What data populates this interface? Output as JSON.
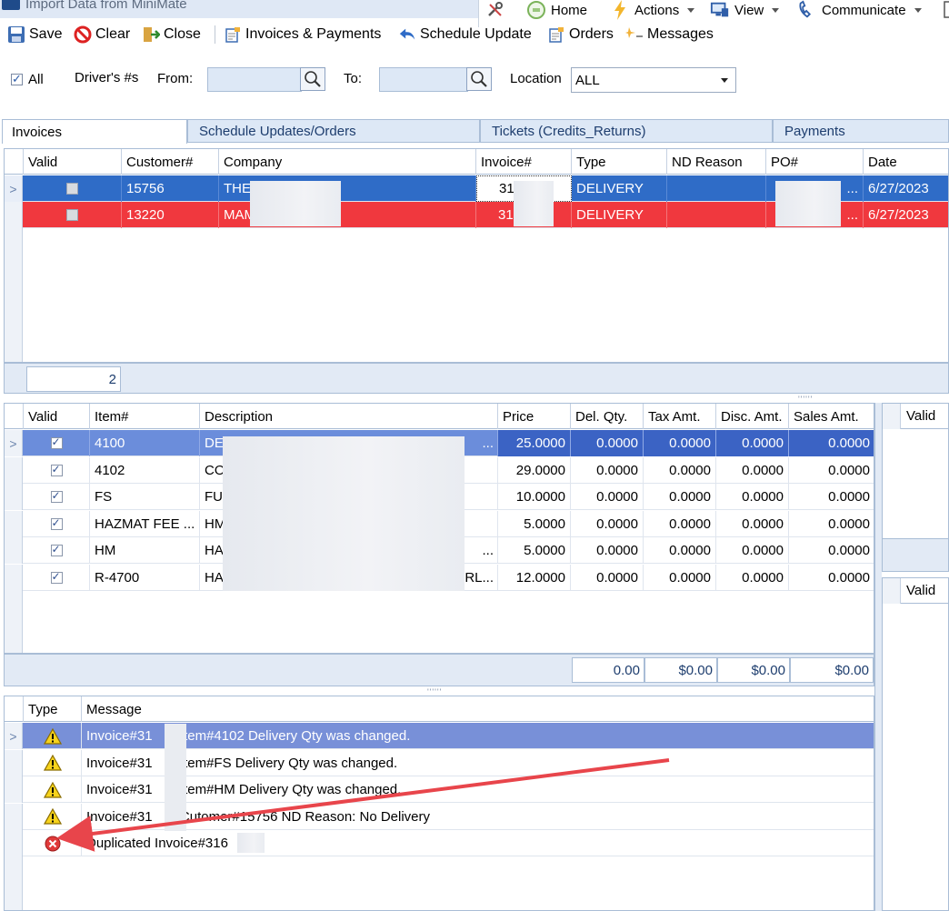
{
  "window": {
    "title": "Import Data from MiniMate"
  },
  "top_menu": [
    {
      "label": "Home",
      "icon": "home-icon"
    },
    {
      "label": "Actions",
      "icon": "lightning-icon"
    },
    {
      "label": "View",
      "icon": "monitor-icon"
    },
    {
      "label": "Communicate",
      "icon": "phone-icon"
    }
  ],
  "toolbar": {
    "save_label": "Save",
    "clear_label": "Clear",
    "close_label": "Close",
    "invoices_payments_label": "Invoices & Payments",
    "schedule_update_label": "Schedule Update",
    "orders_label": "Orders",
    "messages_label": "Messages"
  },
  "filters": {
    "all_label": "All",
    "all_checked": true,
    "drivers_label": "Driver's #s",
    "from_label": "From:",
    "to_label": "To:",
    "location_label": "Location",
    "location_value": "ALL"
  },
  "tabs": [
    {
      "label": "Invoices",
      "active": true
    },
    {
      "label": "Schedule Updates/Orders",
      "active": false
    },
    {
      "label": "Tickets (Credits_Returns)",
      "active": false
    },
    {
      "label": "Payments",
      "active": false
    }
  ],
  "invoices_grid": {
    "headers": [
      "Valid",
      "Customer#",
      "Company",
      "Invoice#",
      "Type",
      "ND Reason",
      "PO#",
      "Date"
    ],
    "rows": [
      {
        "customer": "15756",
        "company": "THE",
        "invoice": "31",
        "type": "DELIVERY",
        "nd_reason": "",
        "po": "...",
        "date": "6/27/2023"
      },
      {
        "customer": "13220",
        "company": "MAM",
        "invoice": "31",
        "type": "DELIVERY",
        "nd_reason": "",
        "po": "...",
        "date": "6/27/2023"
      }
    ],
    "count": "2"
  },
  "items_grid": {
    "headers": [
      "Valid",
      "Item#",
      "Description",
      "Price",
      "Del. Qty.",
      "Tax Amt.",
      "Disc. Amt.",
      "Sales Amt."
    ],
    "rows": [
      {
        "item": "4100",
        "desc": "DE",
        "desc_tail": "...",
        "price": "25.0000",
        "qty": "0.0000",
        "tax": "0.0000",
        "disc": "0.0000",
        "sales": "0.0000"
      },
      {
        "item": "4102",
        "desc": "CO",
        "desc_tail": "",
        "price": "29.0000",
        "qty": "0.0000",
        "tax": "0.0000",
        "disc": "0.0000",
        "sales": "0.0000"
      },
      {
        "item": "FS",
        "desc": "FU",
        "desc_tail": "",
        "price": "10.0000",
        "qty": "0.0000",
        "tax": "0.0000",
        "disc": "0.0000",
        "sales": "0.0000"
      },
      {
        "item": "HAZMAT FEE ...",
        "desc": "HM",
        "desc_tail": "",
        "price": "5.0000",
        "qty": "0.0000",
        "tax": "0.0000",
        "disc": "0.0000",
        "sales": "0.0000"
      },
      {
        "item": "HM",
        "desc": "HA",
        "desc_tail": "...",
        "price": "5.0000",
        "qty": "0.0000",
        "tax": "0.0000",
        "disc": "0.0000",
        "sales": "0.0000"
      },
      {
        "item": "R-4700",
        "desc": "HA",
        "desc_tail": "RL...",
        "price": "12.0000",
        "qty": "0.0000",
        "tax": "0.0000",
        "disc": "0.0000",
        "sales": "0.0000"
      }
    ],
    "totals": {
      "qty": "0.00",
      "tax": "$0.00",
      "disc": "$0.00",
      "sales": "$0.00"
    }
  },
  "side_panel": {
    "valid_label_1": "Valid",
    "valid_label_2": "Valid"
  },
  "messages_grid": {
    "headers": [
      "Type",
      "Message"
    ],
    "rows": [
      {
        "type": "warning",
        "pre": "Invoice#31",
        "post": ": Item#4102 Delivery Qty was changed."
      },
      {
        "type": "warning",
        "pre": "Invoice#31",
        "post": ": Item#FS Delivery Qty was changed."
      },
      {
        "type": "warning",
        "pre": "Invoice#31",
        "post": ": Item#HM Delivery Qty was changed."
      },
      {
        "type": "warning",
        "pre": "Invoice#31",
        "post": ": Cutomer#15756 ND Reason: No Delivery"
      },
      {
        "type": "error",
        "pre": "Duplicated Invoice#316",
        "post": ""
      }
    ]
  },
  "colors": {
    "selected_row": "#2f6cc7",
    "error_row": "#f0383e",
    "annotation_arrow": "#e8454b"
  }
}
